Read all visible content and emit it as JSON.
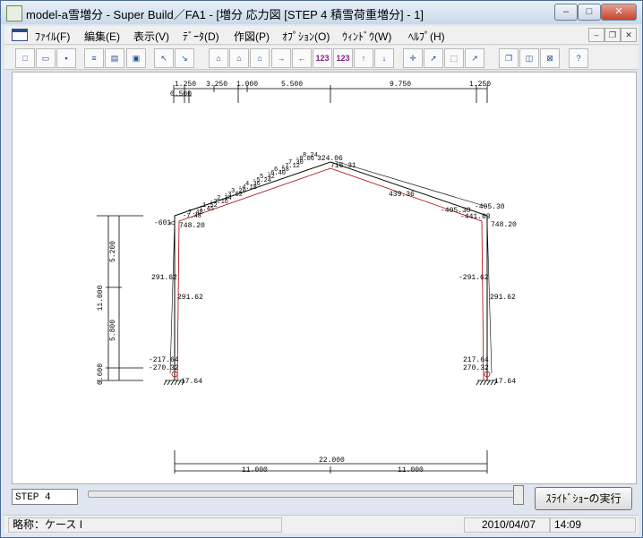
{
  "window": {
    "title": "model-a雪増分 - Super Build／FA1 - [増分 応力図 [STEP 4 積雪荷重増分] - 1]",
    "min": "–",
    "max": "□",
    "close": "✕"
  },
  "menu": [
    "ﾌｧｲﾙ(F)",
    "編集(E)",
    "表示(V)",
    "ﾃﾞｰﾀ(D)",
    "作図(P)",
    "ｵﾌﾟｼｮﾝ(O)",
    "ｳｨﾝﾄﾞｳ(W)",
    "ﾍﾙﾌﾟ(H)"
  ],
  "mdi_buttons": [
    "–",
    "❐",
    "✕"
  ],
  "toolbar_icons": [
    "new-file-icon",
    "open-folder-icon",
    "save-icon",
    "list-icon",
    "table-icon",
    "print-icon",
    "pointer-back-icon",
    "pointer-forward-icon",
    "frame-icon",
    "frame-grid-icon",
    "frame-delete-icon",
    "export-icon",
    "import-icon",
    "label-123-up-icon",
    "label-123-down-icon",
    "arrow-up-icon",
    "arrow-down-icon",
    "select-icon",
    "select-add-icon",
    "select-rect-icon",
    "select-disabled-icon",
    "window-cascade-icon",
    "window-tile-icon",
    "window-close-icon",
    "help-icon"
  ],
  "drawing": {
    "top_dims_row1": [
      "1.250",
      "3.250",
      "1.000",
      "5.500",
      "9.750",
      "1.250"
    ],
    "top_dims_row2": [
      "0.500"
    ],
    "left_dims": [
      "5.200",
      "11.000",
      "5.800",
      "0.600"
    ],
    "bottom_total": "22.000",
    "bottom_dims": [
      "11.000",
      "11.000"
    ],
    "left_col_labels": [
      "748.20",
      "291.62",
      "291.62",
      "-217.64",
      "-270.32",
      "17.64",
      "-601"
    ],
    "right_col_labels": [
      "-405.30",
      "-441.63",
      "748.20",
      "-291.62",
      "291.62",
      "217.64",
      "270.32",
      "17.64",
      "-405.30"
    ],
    "roof_labels": [
      "324.06",
      "715.31",
      "439.36"
    ]
  },
  "controls": {
    "step": "STEP 4",
    "slideshow_button": "ｽﾗｲﾄﾞｼｮｰの実行",
    "slider_fraction": 0.99
  },
  "status": {
    "case": "略称：ケース I",
    "date": "2010/04/07",
    "time": "14:09"
  }
}
